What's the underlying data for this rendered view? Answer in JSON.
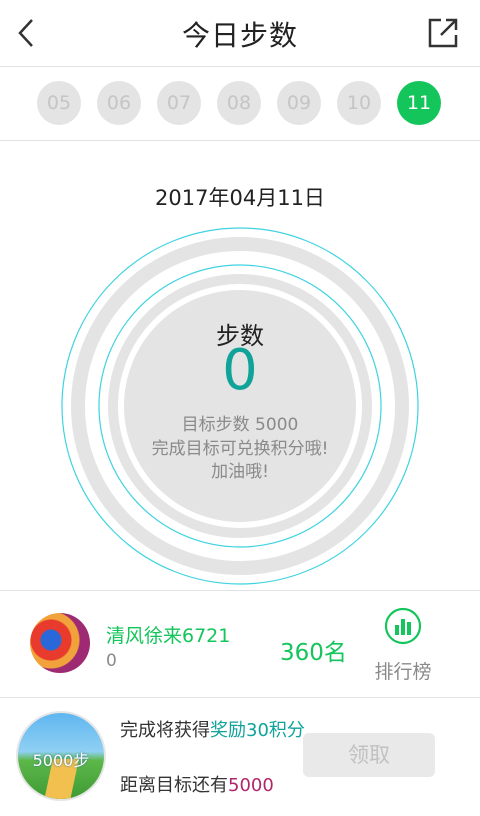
{
  "header": {
    "title": "今日步数",
    "back_icon": "chevron-left-icon",
    "share_icon": "share-external-icon"
  },
  "dates": {
    "items": [
      "05",
      "06",
      "07",
      "08",
      "09",
      "10",
      "11"
    ],
    "selected": "11",
    "active_color": "#14c55b"
  },
  "summary": {
    "date": "2017年04月11日",
    "steps_label": "步数",
    "steps_value": "0",
    "goal_line": "目标步数 5000",
    "message1": "完成目标可兑换积分哦!",
    "message2": "加油哦!",
    "accent_color": "#0fa39a"
  },
  "user": {
    "name": "清风徐来6721",
    "steps": "0",
    "rank": "360名",
    "leaderboard_label": "排行榜",
    "leaderboard_icon": "bar-chart-icon"
  },
  "reward": {
    "badge_text": "5000步",
    "text_prefix": "完成将获得",
    "reward_highlight": "奖励30积分",
    "remaining_prefix": "距离目标还有",
    "remaining_value": "5000",
    "claim_label": "领取"
  }
}
